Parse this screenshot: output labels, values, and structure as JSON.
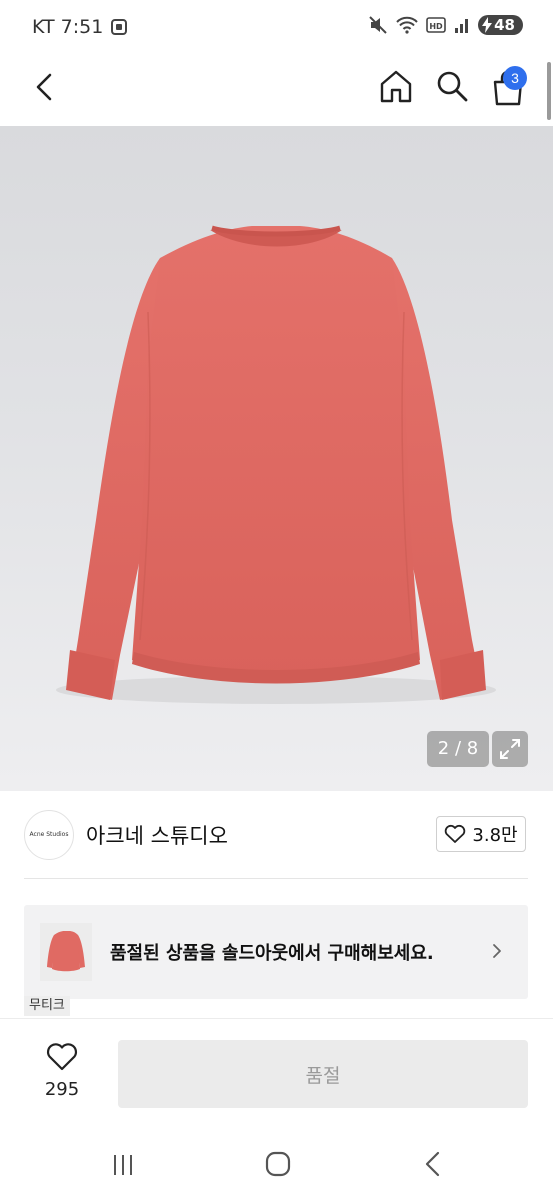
{
  "status_bar": {
    "carrier_time": "KT 7:51",
    "battery": "48"
  },
  "nav": {
    "cart_count": "3"
  },
  "gallery": {
    "counter": "2 / 8"
  },
  "brand": {
    "logo_text": "Acne Studios",
    "name": "아크네 스튜디오",
    "likes": "3.8만"
  },
  "soldout_banner": {
    "text": "품절된 상품을 솔드아웃에서 구매해보세요.",
    "tag": "무티크"
  },
  "bottom_bar": {
    "wish_count": "295",
    "action_label": "품절"
  },
  "colors": {
    "accent": "#2f6fed",
    "product": "#e06a63",
    "disabled_bg": "#ebebeb"
  }
}
